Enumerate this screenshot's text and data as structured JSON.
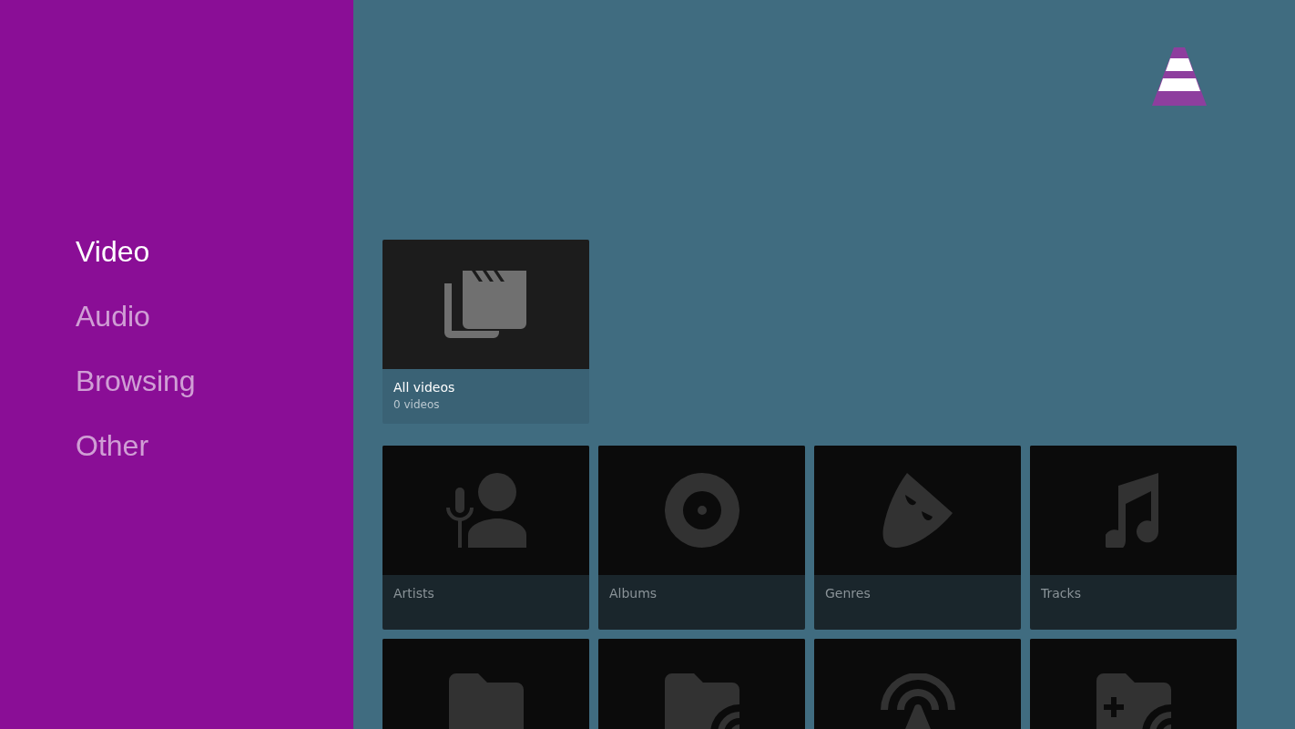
{
  "sidebar": {
    "items": [
      {
        "label": "Video",
        "selected": true
      },
      {
        "label": "Audio",
        "selected": false
      },
      {
        "label": "Browsing",
        "selected": false
      },
      {
        "label": "Other",
        "selected": false
      }
    ]
  },
  "sections": [
    {
      "cards": [
        {
          "kind": "videos",
          "title": "All videos",
          "subtitle": "0 videos",
          "focused": true
        }
      ]
    },
    {
      "cards": [
        {
          "kind": "artists",
          "title": "Artists",
          "focused": false
        },
        {
          "kind": "albums",
          "title": "Albums",
          "focused": false
        },
        {
          "kind": "genres",
          "title": "Genres",
          "focused": false
        },
        {
          "kind": "tracks",
          "title": "Tracks",
          "focused": false
        },
        {
          "kind": "folder",
          "focused": false
        },
        {
          "kind": "network-folder",
          "focused": false
        },
        {
          "kind": "stream",
          "focused": false
        },
        {
          "kind": "add-network-folder",
          "focused": false
        }
      ]
    }
  ]
}
